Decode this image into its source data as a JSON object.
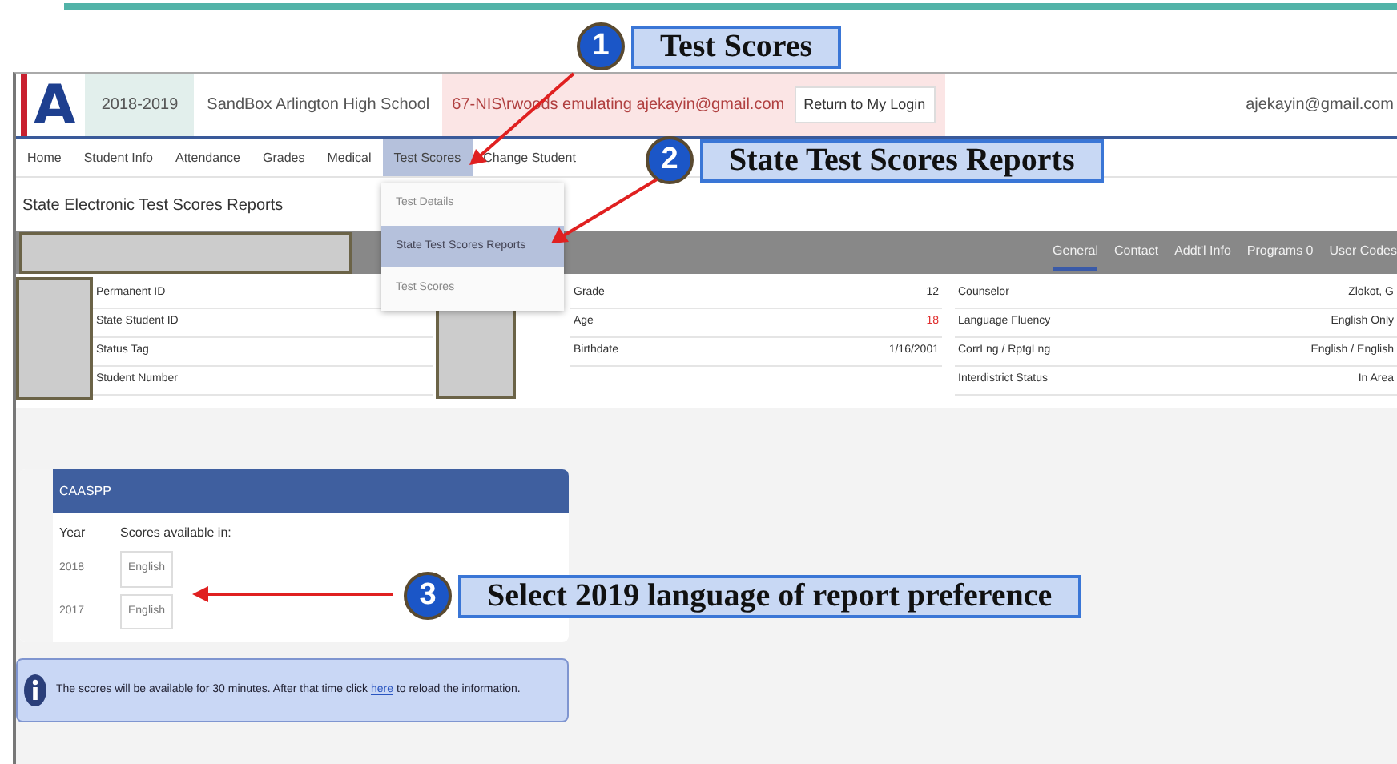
{
  "callouts": [
    {
      "number": "1",
      "text": "Test Scores"
    },
    {
      "number": "2",
      "text": "State Test Scores Reports"
    },
    {
      "number": "3",
      "text": "Select 2019 language of report preference"
    }
  ],
  "header": {
    "logo": "A",
    "year": "2018-2019",
    "school": "SandBox Arlington High School",
    "emulation": "67-NIS\\rwoods emulating ajekayin@gmail.com",
    "return_button": "Return to My Login",
    "user": "ajekayin@gmail.com"
  },
  "nav": [
    {
      "label": "Home",
      "selected": false
    },
    {
      "label": "Student Info",
      "selected": false
    },
    {
      "label": "Attendance",
      "selected": false
    },
    {
      "label": "Grades",
      "selected": false
    },
    {
      "label": "Medical",
      "selected": false
    },
    {
      "label": "Test Scores",
      "selected": true
    },
    {
      "label": "Change Student",
      "selected": false
    }
  ],
  "page_title": "State Electronic Test Scores Reports",
  "dropdown": [
    {
      "label": "Test Details",
      "selected": false
    },
    {
      "label": "State Test Scores Reports",
      "selected": true
    },
    {
      "label": "Test Scores",
      "selected": false
    }
  ],
  "student_tabs": [
    {
      "label": "General",
      "selected": true
    },
    {
      "label": "Contact",
      "selected": false
    },
    {
      "label": "Addt'l Info",
      "selected": false
    },
    {
      "label": "Programs 0",
      "selected": false
    },
    {
      "label": "User Codes",
      "selected": false
    }
  ],
  "id_fields": [
    "Permanent ID",
    "State Student ID",
    "Status Tag",
    "Student Number"
  ],
  "details": [
    {
      "label": "Grade",
      "value": "12",
      "highlighted": false
    },
    {
      "label": "Age",
      "value": "18",
      "highlighted": true
    },
    {
      "label": "Birthdate",
      "value": "1/16/2001",
      "highlighted": false
    }
  ],
  "more_details": [
    {
      "label": "Counselor",
      "value": "Zlokot, G"
    },
    {
      "label": "Language Fluency",
      "value": "English Only"
    },
    {
      "label": "CorrLng / RptgLng",
      "value": "English / English"
    },
    {
      "label": "Interdistrict Status",
      "value": "In Area"
    }
  ],
  "caaspp": {
    "title": "CAASPP",
    "columns": [
      "Year",
      "Scores available in:"
    ],
    "rows": [
      {
        "year": "2018",
        "language": "English"
      },
      {
        "year": "2017",
        "language": "English"
      }
    ]
  },
  "notice": {
    "text_before": "The scores will be available for 30 minutes. After that time click ",
    "link": "here",
    "text_after": " to reload the information."
  }
}
